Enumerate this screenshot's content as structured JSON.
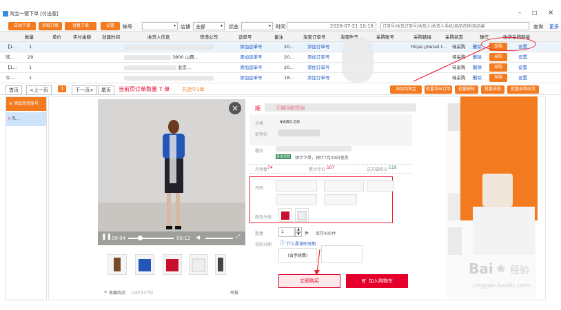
{
  "window": {
    "title": "淘宝一键下单 [付出版]",
    "min_label": "–",
    "max_label": "□",
    "close_label": "×"
  },
  "toolbar": {
    "buttons": [
      "自动下单",
      "获取订单",
      "批量下单",
      "设置"
    ],
    "account_label": "帐号",
    "shop_label": "店铺",
    "shop_value": "全部",
    "status_label": "状态",
    "time_label": "时间",
    "date_value": "2020-07-21 10:16",
    "search_placeholder": "订单号/收货订单号/收货人/收货人手机/商品名称/商品编",
    "search_btn": "查询",
    "more_btn": "更多"
  },
  "table": {
    "headers": [
      "数量",
      "单价",
      "实付金额",
      "创建时间",
      "收货人信息",
      "快递公司",
      "运单号",
      "备注",
      "淘宝订单号",
      "淘宝账号",
      "采购账号",
      "采购链接",
      "采购状态",
      "操作",
      "收货采购链接"
    ],
    "rows": [
      {
        "col0": "【1...",
        "qty": "1",
        "tracking": "添加运单号",
        "note": "20...",
        "order": "添加订单号",
        "link": "https://detail.t...",
        "status": "待采购",
        "del": "删除",
        "action": "采购",
        "setting": "设置"
      },
      {
        "col0": "欣...",
        "qty": "29",
        "addr": "3800 山西...",
        "tracking": "添加运单号",
        "note": "20...",
        "order": "添加订单号",
        "status": "待采购",
        "del": "删除",
        "action": "采购",
        "setting": "设置"
      },
      {
        "col0": "【1...",
        "qty": "1",
        "addr": "北京...",
        "tracking": "添加运单号",
        "note": "20...",
        "order": "添加订单号",
        "status": "待采购",
        "del": "删除",
        "action": "采购",
        "setting": "设置"
      },
      {
        "col0": "今...",
        "qty": "1",
        "tracking": "添加运单号",
        "note": "18...",
        "order": "添加订单号",
        "status": "待采购",
        "del": "删除",
        "action": "采购",
        "setting": "设置"
      }
    ]
  },
  "pager": {
    "first": "首页",
    "prev": "<上一页",
    "current": "1",
    "next": "下一页>",
    "last": "尾页",
    "count_text": "当前页订单数量 7 单",
    "selected_text": "共选中1单",
    "right_buttons": [
      "添加到淘宝",
      "批量导出订单",
      "批量删除",
      "批量采购",
      "批量采购收货"
    ]
  },
  "sidebar": {
    "header": "添加淘宝账号",
    "item": "fi..."
  },
  "product": {
    "title_prefix": "顺",
    "title_tag": "天猫同款短袖",
    "price_label": "价格",
    "price": "¥480.00",
    "promo_label": "促销价",
    "service_label": "服务",
    "service_tag": "极速退款",
    "service_text": "预计下单，预计7月29日发货",
    "monthly_label": "月销量",
    "monthly": "74",
    "review_label": "累计评价",
    "review": "107",
    "points_label": "送天猫积分",
    "points": "119",
    "size_label": "尺码",
    "color_label": "颜色分类",
    "qty_label": "数量",
    "qty": "1",
    "unit": "件",
    "stock": "库存400件",
    "installment_label": "花呗分期",
    "installment_link": "什么是花呗分期",
    "installment_option": "(含手续费)",
    "buy_label": "立即购买",
    "cart_label": "加入购物车",
    "video_time_start": "00:04",
    "video_time_end": "00:12",
    "fav_label": "收藏商品",
    "fav_count": "(1073人气)",
    "report_label": "举报"
  },
  "watermark": {
    "brand": "Bai",
    "brand2": "经验",
    "url": "jingyan.baidu.com"
  },
  "colors": {
    "orange": "#f47a1f",
    "blue": "#1a56c9",
    "red": "#e4002b",
    "green": "#2e8b57"
  }
}
